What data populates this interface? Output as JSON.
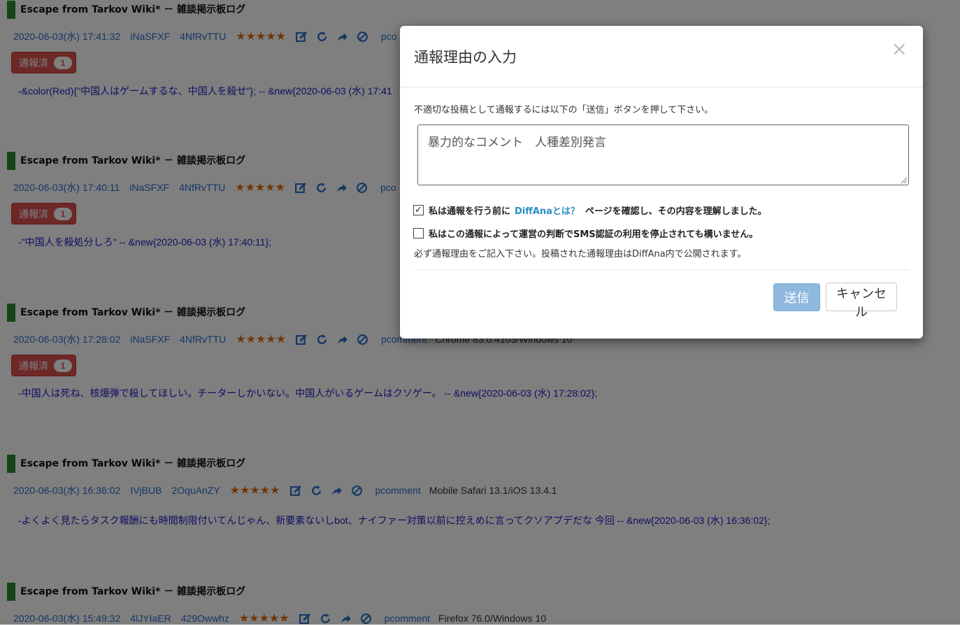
{
  "posts": [
    {
      "title": "Escape from Tarkov Wiki* － 雑談掲示板ログ",
      "date": "2020-06-03(水) 17:41:32",
      "uid": "iNaSFXF",
      "hash": "4NfRvTTU",
      "stars": "★★★★★",
      "pcomment": "pco",
      "ua": "",
      "badge": {
        "label": "通報済",
        "count": "1"
      },
      "body": "-&color(Red){\"中国人はゲームするな、中国人を殺せ\"}; -- &new{2020-06-03 (水) 17:41"
    },
    {
      "title": "Escape from Tarkov Wiki* － 雑談掲示板ログ",
      "date": "2020-06-03(水) 17:40:11",
      "uid": "iNaSFXF",
      "hash": "4NfRvTTU",
      "stars": "★★★★★",
      "pcomment": "pco",
      "ua": "",
      "badge": {
        "label": "通報済",
        "count": "1"
      },
      "body": "-\"中国人を殺処分しろ\" -- &new{2020-06-03 (水) 17:40:11};"
    },
    {
      "title": "Escape from Tarkov Wiki* － 雑談掲示板ログ",
      "date": "2020-06-03(水) 17:28:02",
      "uid": "iNaSFXF",
      "hash": "4NfRvTTU",
      "stars": "★★★★★",
      "pcomment": "pcomment",
      "ua": "Chrome 83.0.4103/Windows 10",
      "badge": {
        "label": "通報済",
        "count": "1"
      },
      "body": "-中国人は死ね、核爆弾で殺してほしい。チーターしかいない。中国人がいるゲームはクソゲー。 -- &new{2020-06-03 (水) 17:28:02};"
    },
    {
      "title": "Escape from Tarkov Wiki* － 雑談掲示板ログ",
      "date": "2020-06-03(水) 16:36:02",
      "uid": "IVjBUB",
      "hash": "2OquAnZY",
      "stars": "★★★★★",
      "pcomment": "pcomment",
      "ua": "Mobile Safari 13.1/iOS 13.4.1",
      "badge": null,
      "body": "-よくよく見たらタスク報酬にも時間制限付いてんじゃん、新要素ないしbot、ナイファー対策以前に控えめに言ってクソアプデだな 今回 -- &new{2020-06-03 (水) 16:36:02};"
    },
    {
      "title": "Escape from Tarkov Wiki* － 雑談掲示板ログ",
      "date": "2020-06-03(水) 15:49:32",
      "uid": "4lJYIaER",
      "hash": "429Owwhz",
      "stars": "★★★★★",
      "pcomment": "pcomment",
      "ua": "Firefox 76.0/Windows 10",
      "badge": null,
      "body": ""
    }
  ],
  "modal": {
    "title": "通報理由の入力",
    "close_symbol": "×",
    "instruction": "不適切な投稿として通報するには以下の「送信」ボタンを押して下さい。",
    "reason_value": "暴力的なコメント　人種差別発言",
    "check1": {
      "before": "私は通報を行う前に",
      "link": "DiffAnaとは？",
      "after": "ページを確認し、その内容を理解しました。",
      "checked": true
    },
    "check2": {
      "text": "私はこの通報によって運営の判断でSMS認証の利用を停止されても構いません。",
      "checked": false
    },
    "note": "必ず通報理由をご記入下さい。投稿された通報理由はDiffAna内で公開されます。",
    "send_label": "送信",
    "cancel_label": "キャンセル",
    "check_mark": "✓"
  },
  "colors": {
    "accent": "#2e8b2e",
    "badge": "#d9534f",
    "link": "#2a6ec8",
    "body_text": "#1c1cc4",
    "stars": "#e36c0a"
  }
}
